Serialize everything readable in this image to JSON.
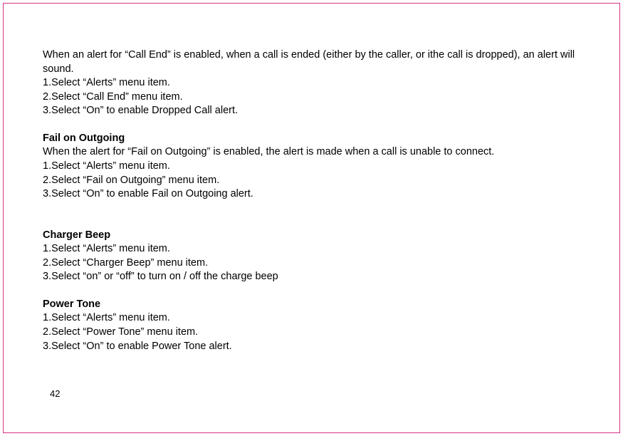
{
  "intro": {
    "p1": "When an alert for “Call End” is enabled, when a call is ended (either by the caller,  or ithe call is dropped), an alert will sound.",
    "l1": "1.Select “Alerts” menu item.",
    "l2": "2.Select “Call End” menu item.",
    "l3": "3.Select “On” to enable Dropped Call alert."
  },
  "fail": {
    "heading": "Fail on Outgoing",
    "p1": "When the alert for “Fail on Outgoing” is enabled, the alert is made when a call is unable to connect.",
    "l1": "1.Select “Alerts” menu item.",
    "l2": "2.Select “Fail on Outgoing” menu item.",
    "l3": "3.Select “On” to enable Fail on Outgoing alert."
  },
  "charger": {
    "heading": "Charger Beep",
    "l1": "1.Select “Alerts” menu item.",
    "l2": "2.Select “Charger Beep” menu item.",
    "l3": "3.Select “on” or “off” to turn on / off the charge beep"
  },
  "power": {
    "heading": "Power Tone",
    "l1": "1.Select “Alerts” menu item.",
    "l2": "2.Select “Power Tone” menu item.",
    "l3": "3.Select “On” to enable Power Tone alert."
  },
  "pageNumber": "42"
}
